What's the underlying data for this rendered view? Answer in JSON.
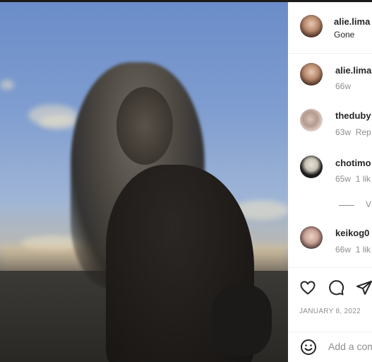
{
  "post": {
    "author": "alie.lima",
    "caption": "Gone",
    "date": "JANUARY 8, 2022"
  },
  "comments": [
    {
      "username": "alie.lima",
      "time": "66w",
      "extra": ""
    },
    {
      "username": "theduby",
      "time": "63w",
      "extra": "Rep"
    },
    {
      "username": "chotimo",
      "time": "65w",
      "extra": "1 lik"
    },
    {
      "username": "keikog0",
      "time": "66w",
      "extra": "1 lik"
    }
  ],
  "view_replies": "V",
  "add_comment": {
    "placeholder": "Add a com"
  },
  "icons": {
    "like": "heart-icon",
    "comment": "comment-bubble-icon",
    "share": "paper-plane-icon",
    "emoji": "smiley-face-icon"
  },
  "colors": {
    "text": "#262626",
    "muted": "#8e8e8e",
    "divider": "#efefef"
  }
}
